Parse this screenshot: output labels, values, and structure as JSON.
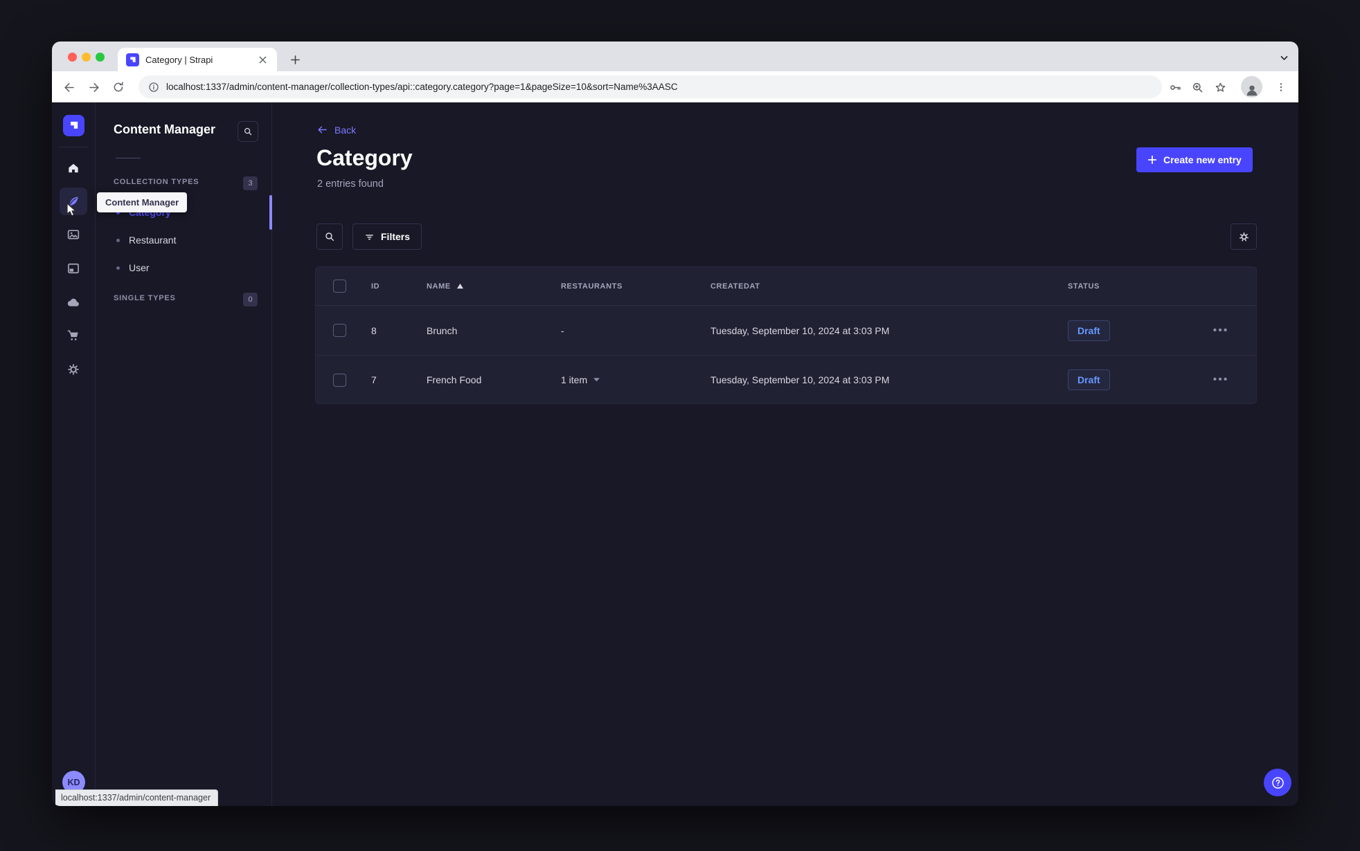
{
  "browser": {
    "tab_title": "Category | Strapi",
    "url": "localhost:1337/admin/content-manager/collection-types/api::category.category?page=1&pageSize=10&sort=Name%3AASC",
    "status_tooltip": "localhost:1337/admin/content-manager"
  },
  "subnav": {
    "title": "Content Manager",
    "tooltip": "Content Manager",
    "collection": {
      "label": "COLLECTION TYPES",
      "count": "3"
    },
    "single": {
      "label": "SINGLE TYPES",
      "count": "0"
    },
    "items": [
      {
        "label": "Category",
        "active": true
      },
      {
        "label": "Restaurant",
        "active": false
      },
      {
        "label": "User",
        "active": false
      }
    ]
  },
  "main": {
    "back_label": "Back",
    "title": "Category",
    "subtitle": "2 entries found",
    "create_button_label": "Create new entry",
    "filters_label": "Filters"
  },
  "table": {
    "headers": {
      "id": "ID",
      "name": "NAME",
      "restaurants": "RESTAURANTS",
      "createdat": "CREATEDAT",
      "status": "STATUS"
    },
    "rows": [
      {
        "id": "8",
        "name": "Brunch",
        "restaurants": "-",
        "createdAt": "Tuesday, September 10, 2024 at 3:03 PM",
        "status": "Draft"
      },
      {
        "id": "7",
        "name": "French Food",
        "restaurants": "1 item",
        "createdAt": "Tuesday, September 10, 2024 at 3:03 PM",
        "status": "Draft"
      }
    ]
  },
  "user": {
    "initials": "KD"
  },
  "colors": {
    "primary": "#4945ff",
    "primary_light": "#7b79ff",
    "app_background": "#181826",
    "card_background": "#212134",
    "draft_text": "#6698ff"
  }
}
